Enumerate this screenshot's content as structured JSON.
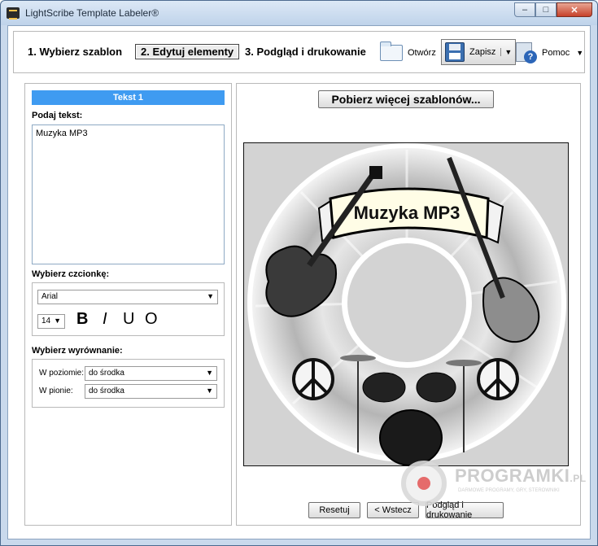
{
  "window": {
    "title": "LightScribe Template Labeler®",
    "minimize": "–",
    "maximize": "□",
    "close": "✕"
  },
  "toolbar": {
    "step1": "1. Wybierz szablon",
    "step2": "2. Edytuj elementy",
    "step3": "3. Podgląd i drukowanie",
    "open_label": "Otwórz",
    "save_label": "Zapisz",
    "help_label": "Pomoc",
    "help_glyph": "?",
    "dropdown_glyph": "▼"
  },
  "left": {
    "header": "Tekst 1",
    "text_label": "Podaj tekst:",
    "text_value": "Muzyka MP3",
    "font_label": "Wybierz czcionkę:",
    "font_value": "Arial",
    "size_value": "14",
    "bold": "B",
    "italic": "I",
    "underline": "U",
    "outline": "O",
    "align_label": "Wybierz wyrównanie:",
    "horizontal_label": "W poziomie:",
    "horizontal_value": "do środka",
    "vertical_label": "W pionie:",
    "vertical_value": "do środka"
  },
  "right": {
    "more_templates": "Pobierz więcej szablonów...",
    "disc_title": "Muzyka MP3",
    "reset": "Resetuj",
    "back": "< Wstecz",
    "preview_print": "Podgląd i drukowanie"
  },
  "watermark": {
    "name": "PROGRAMKI",
    "suffix": ".PL",
    "tagline": "DARMOWE PROGRAMY, GRY, STEROWNIKI"
  }
}
